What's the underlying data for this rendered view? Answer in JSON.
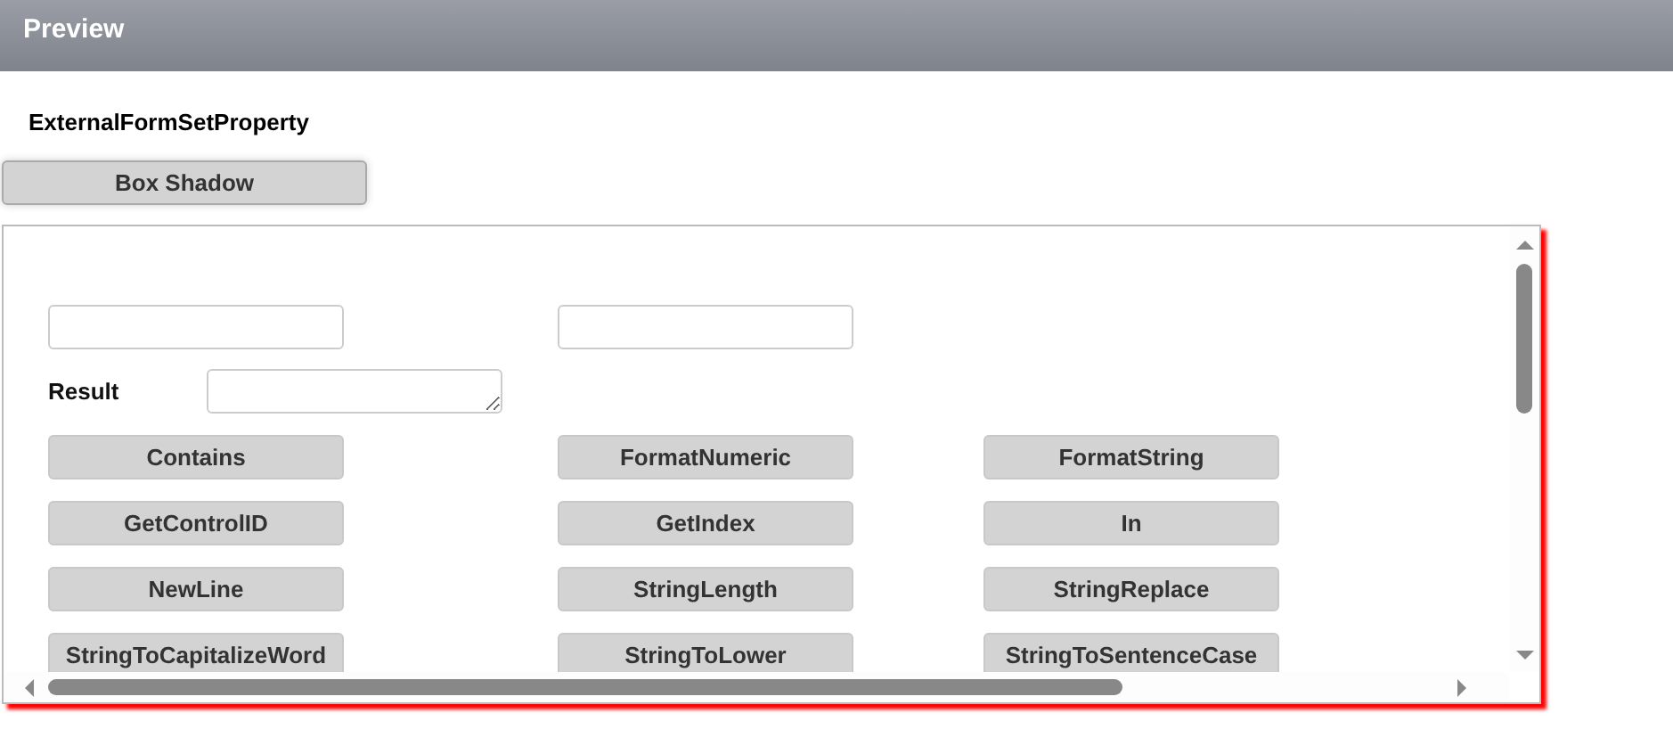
{
  "window": {
    "title": "Preview"
  },
  "heading": "ExternalFormSetProperty",
  "box_shadow_button": {
    "label": "Box Shadow"
  },
  "fields": [
    {
      "kind": "text"
    },
    {
      "kind": "text"
    },
    {
      "kind": "textarea",
      "label": "Result"
    }
  ],
  "function_buttons": [
    "Contains",
    "FormatNumeric",
    "FormatString",
    "GetControlID",
    "GetIndex",
    "In",
    "NewLine",
    "StringLength",
    "StringReplace",
    "StringToCapitalizeWord",
    "StringToLower",
    "StringToSentenceCase"
  ]
}
